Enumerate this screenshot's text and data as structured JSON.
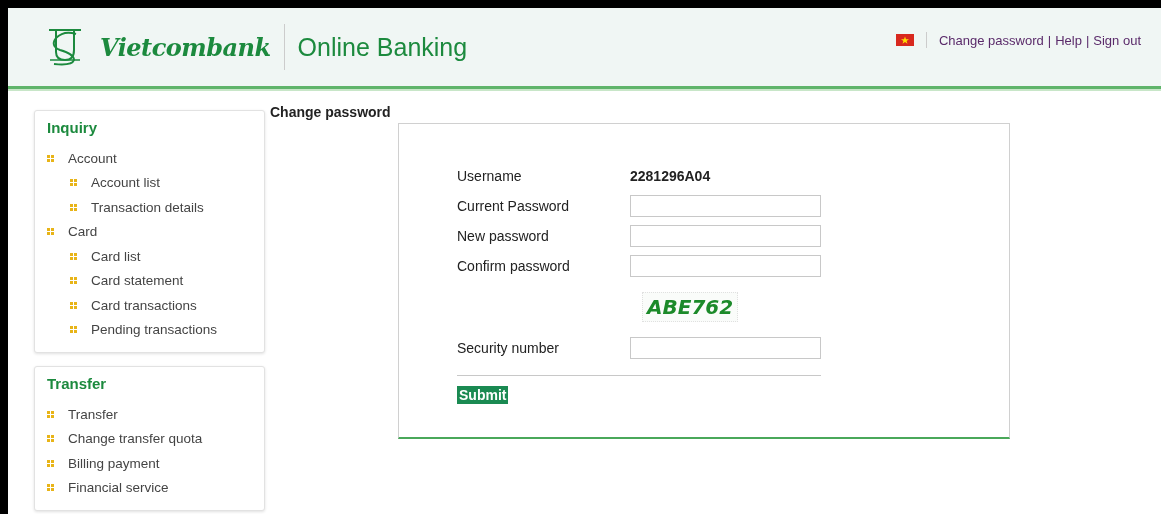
{
  "header": {
    "brand": "Vietcombank",
    "product": "Online Banking",
    "links": [
      "Change password",
      "Help",
      "Sign out"
    ],
    "separators": [
      "|",
      "|"
    ]
  },
  "sidebar": [
    {
      "title": "Inquiry",
      "items": [
        {
          "label": "Account",
          "children": [
            {
              "label": "Account list"
            },
            {
              "label": "Transaction details"
            }
          ]
        },
        {
          "label": "Card",
          "children": [
            {
              "label": "Card list"
            },
            {
              "label": "Card statement"
            },
            {
              "label": "Card transactions"
            },
            {
              "label": "Pending transactions"
            }
          ]
        }
      ]
    },
    {
      "title": "Transfer",
      "items": [
        {
          "label": "Transfer"
        },
        {
          "label": "Change transfer quota"
        },
        {
          "label": "Billing payment"
        },
        {
          "label": "Financial service"
        }
      ]
    }
  ],
  "page_title": "Change password",
  "form": {
    "rows": [
      {
        "kind": "text",
        "label": "Username",
        "value": "2281296A04"
      },
      {
        "kind": "input",
        "label": "Current Password"
      },
      {
        "kind": "input",
        "label": "New password"
      },
      {
        "kind": "input",
        "label": "Confirm password"
      },
      {
        "kind": "captcha",
        "value": "ABE762"
      },
      {
        "kind": "input",
        "label": "Security number"
      }
    ],
    "submit": "Submit"
  }
}
